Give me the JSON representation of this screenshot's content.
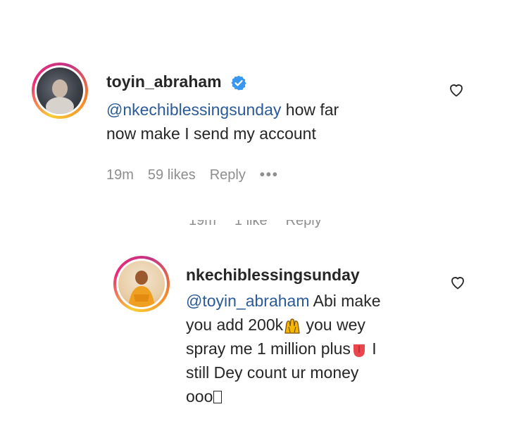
{
  "comment1": {
    "username": "toyin_abraham",
    "mention": "@nkechiblessingsunday",
    "text_line1_rest": " how far",
    "text_line2": "now make I send my account",
    "time": "19m",
    "likes": "59 likes",
    "reply": "Reply",
    "more": "•••",
    "verified_color": "#3897f0"
  },
  "hidden_meta": {
    "time": "19m",
    "likes": "1 like",
    "reply": "Reply"
  },
  "comment2": {
    "username": "nkechiblessingsunday",
    "mention": "@toyin_abraham",
    "text_line1_rest": " Abi make",
    "text_line2_a": "you add 200k",
    "text_line2_b": " you wey",
    "text_line3_a": "spray me 1 million plus",
    "text_line3_b": " I",
    "text_line4": "still Dey count ur money",
    "text_line5": "ooo",
    "emoji_1": "raised-hands-icon",
    "emoji_2": "tongue-icon"
  },
  "colors": {
    "text": "#262626",
    "muted": "#8e8e8e",
    "mention": "#2b5a99"
  }
}
